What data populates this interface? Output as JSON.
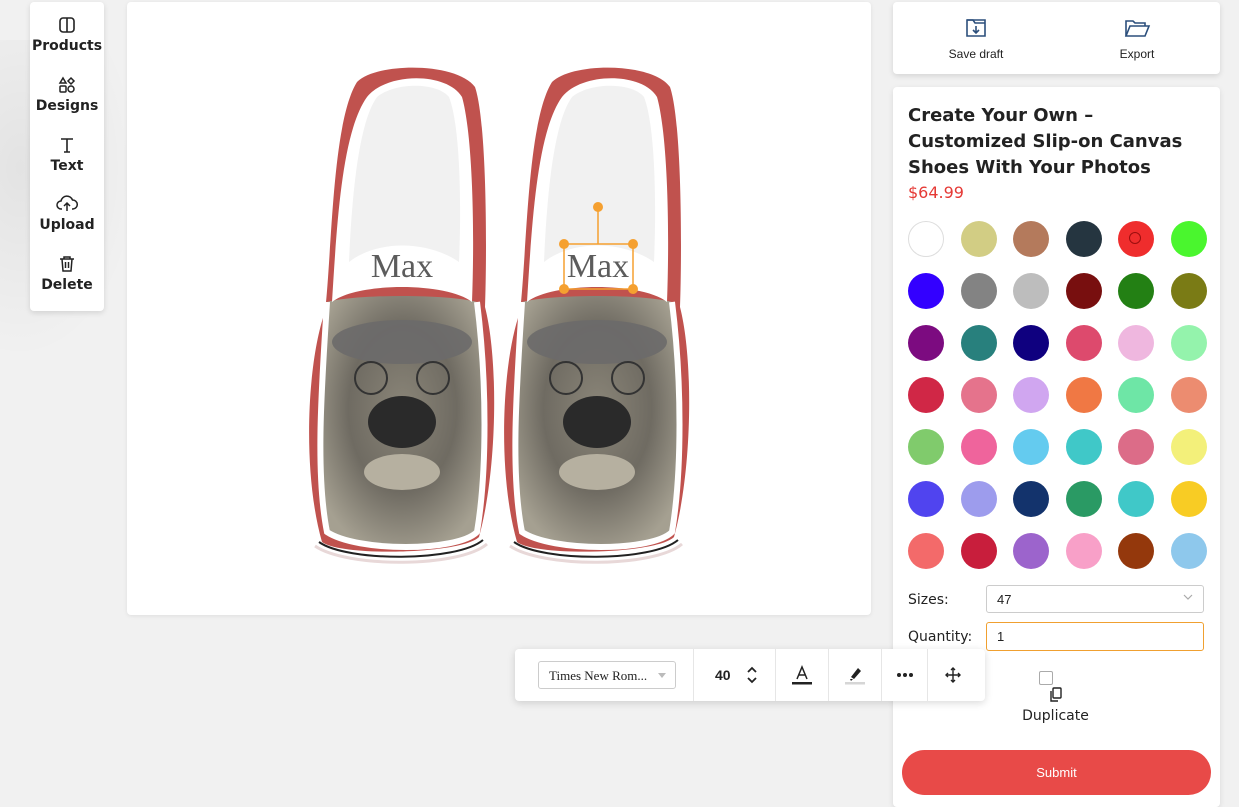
{
  "sidebar": {
    "items": [
      {
        "label": "Products",
        "icon": "products-icon"
      },
      {
        "label": "Designs",
        "icon": "designs-icon"
      },
      {
        "label": "Text",
        "icon": "text-icon"
      },
      {
        "label": "Upload",
        "icon": "upload-icon"
      },
      {
        "label": "Delete",
        "icon": "trash-icon"
      }
    ]
  },
  "topbar": {
    "save_draft": "Save draft",
    "export": "Export"
  },
  "canvas": {
    "left_shoe_text": "Max",
    "right_shoe_text": "Max",
    "shoe_color": "#c0524e"
  },
  "product": {
    "title": "Create Your Own – Customized Slip-on Canvas Shoes With Your Photos",
    "price": "$64.99",
    "selected_color": "#ef2d2d"
  },
  "colors": [
    "#ffffff",
    "#d2cd84",
    "#b47a5c",
    "#253540",
    "#ef2d2d",
    "#4af62e",
    "#3300ff",
    "#838383",
    "#bdbdbd",
    "#780f0f",
    "#238014",
    "#7a7b15",
    "#7c0b80",
    "#28807d",
    "#0f007f",
    "#dd4a6d",
    "#efb7df",
    "#94f3ac",
    "#d02746",
    "#e5738c",
    "#d0a6f0",
    "#f07844",
    "#6ee6a6",
    "#ec8c70",
    "#80cb6c",
    "#ef649c",
    "#64cbef",
    "#40c8c8",
    "#dc6c88",
    "#f3f07a",
    "#5044ef",
    "#9d9ced",
    "#13336c",
    "#2a9a64",
    "#40c8c8",
    "#f8cc24",
    "#f36a6a",
    "#c81e3c",
    "#9c64cc",
    "#f8a0c8",
    "#94380c",
    "#8ec8ec"
  ],
  "options": {
    "sizes_label": "Sizes:",
    "sizes_value": "47",
    "quantity_label": "Quantity:",
    "quantity_value": "1",
    "duplicate_label": "Duplicate",
    "submit_label": "Submit"
  },
  "text_toolbar": {
    "font_family": "Times New Rom...",
    "font_size": "40"
  }
}
